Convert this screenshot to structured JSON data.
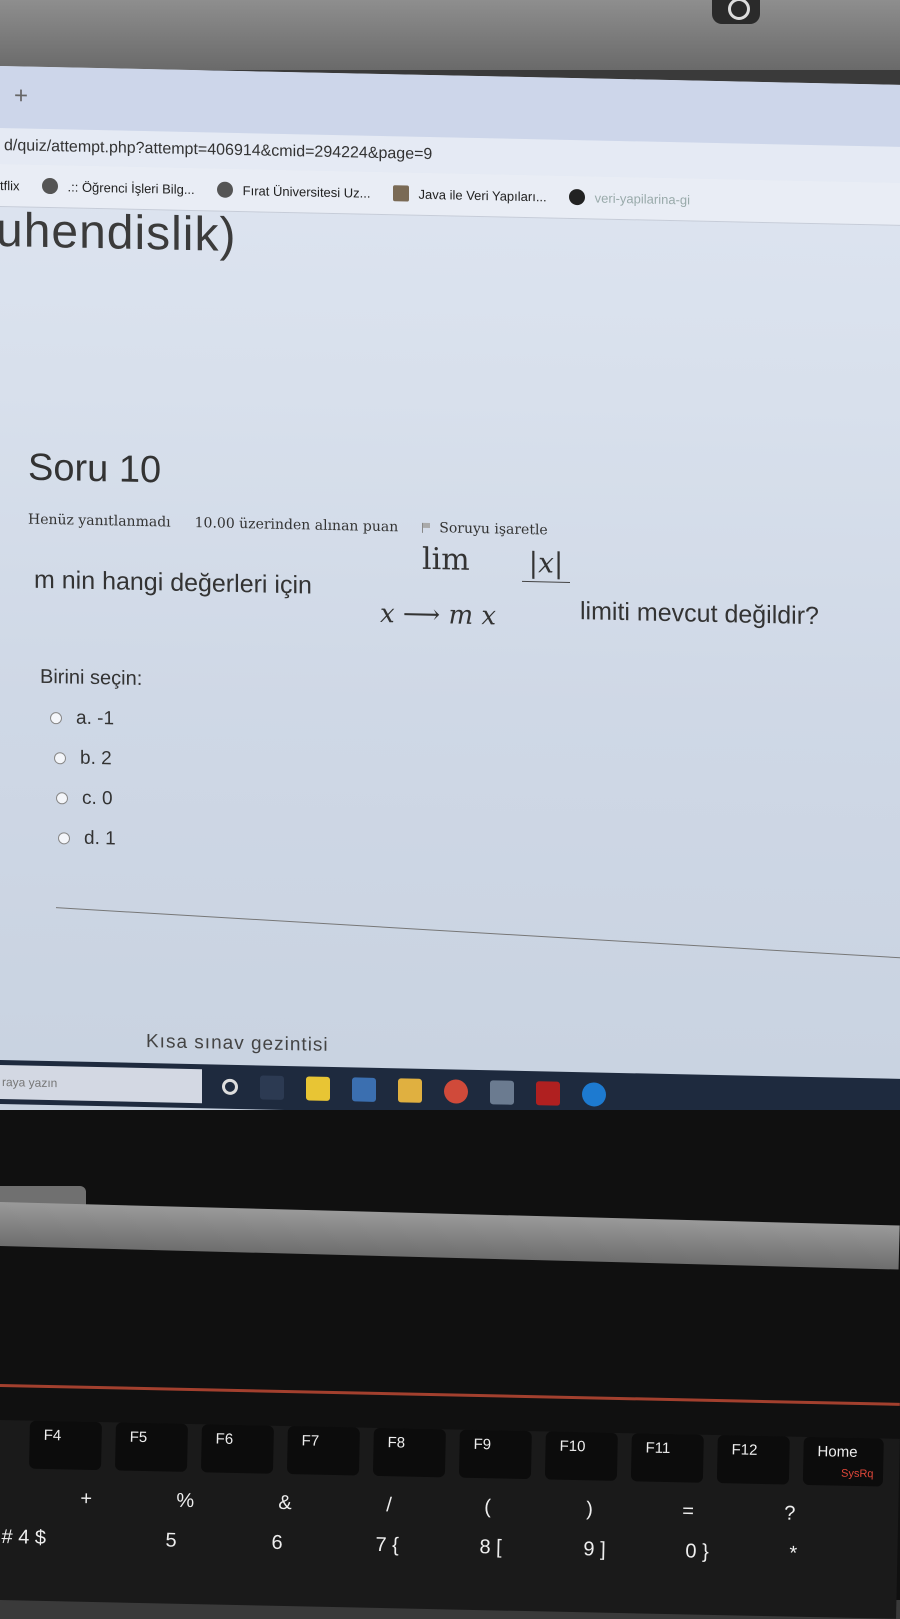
{
  "browser": {
    "newtab_symbol": "+",
    "url": "d/quiz/attempt.php?attempt=406914&cmid=294224&page=9",
    "bookmarks": [
      {
        "label": "tflix",
        "icon": "none"
      },
      {
        "label": ".:: Öğrenci İşleri Bilg...",
        "icon": "globe-icon"
      },
      {
        "label": "Fırat Üniversitesi Uz...",
        "icon": "site-icon"
      },
      {
        "label": "Java ile Veri Yapıları...",
        "icon": "book-icon"
      },
      {
        "label": "veri-yapilarina-gi",
        "icon": "github-icon"
      }
    ]
  },
  "page": {
    "site_title": "uhendislik)"
  },
  "question": {
    "number_label": "Soru 10",
    "status": "Henüz yanıtlanmadı",
    "grade": "10.00 üzerinden alınan puan",
    "flag_label": "Soruyu işaretle",
    "text_before": "m nin hangi değerleri için",
    "text_after": "limiti mevcut değildir?",
    "math": {
      "lim": "lim",
      "subscript": "x ⟶ m  x",
      "numerator": "|x|"
    },
    "choose_label": "Birini seçin:",
    "options": [
      "a. -1",
      "b. 2",
      "c. 0",
      "d. 1"
    ]
  },
  "footer": {
    "quiz_navigation": "Kısa sınav gezintisi"
  },
  "taskbar": {
    "search_placeholder": "raya yazın"
  },
  "keyboard": {
    "fkeys": [
      "F4",
      "F5",
      "F6",
      "F7",
      "F8",
      "F9",
      "F10",
      "F11",
      "F12",
      "Home"
    ],
    "home_sub": "SysRq",
    "symbols": [
      "+",
      "%",
      "&",
      "/",
      "(",
      ")",
      "=",
      "?"
    ],
    "numbers": [
      "# 4 $",
      "5",
      "6",
      "7 {",
      "8 [",
      "9 ]",
      "0 }",
      "*"
    ]
  }
}
